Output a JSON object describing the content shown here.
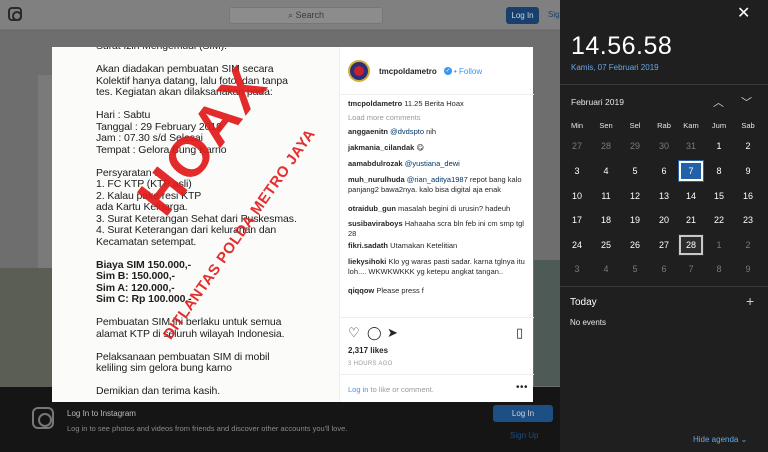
{
  "instagram": {
    "search_placeholder": "Search",
    "login_label": "Log In",
    "signup_label": "Sign Up",
    "bottom_bar": {
      "title": "Log In to Instagram",
      "subtitle": "Log in to see photos and videos from friends and discover other accounts you'll love.",
      "login_label": "Log In",
      "signup_label": "Sign Up"
    }
  },
  "post": {
    "image_text": {
      "lines": [
        "Surat Izin Mengemudi (SIM).",
        "",
        "Akan diadakan pembuatan SIM secara",
        "Kolektif hanya datang, lalu foto, dan tanpa",
        "tes. Kegiatan akan dilaksanakan pada:",
        "",
        "Hari     : Sabtu",
        "Tanggal : 29 February 2019",
        "Jam       : 07.30 s/d  Selesai",
        "Tempat : Gelora Bung Karno",
        "",
        "Persyaratan :",
        "1. FC KTP (KTP asli)",
        "2. Kalau pake resi KTP",
        "ada Kartu Keluarga.",
        "3. Surat Keterangan Sehat dari Puskesmas.",
        "4. Surat Keterangan dari kelurahan dan",
        "Kecamatan setempat.",
        "",
        "Biaya SIM 150.000,-",
        "Sim B: 150.000,-",
        "Sim A: 120.000,-",
        "Sim C: Rp 100.000,-",
        "",
        "Pembuatan SIM ini berlaku untuk semua",
        "alamat KTP di seluruh wilayah Indonesia.",
        "",
        "Pelaksanaan pembuatan SIM di mobil",
        "keliling sim gelora bung karno",
        "",
        "Demikian dan terima kasih."
      ],
      "stamp": "HOAX",
      "stamp_sub": "DITLANTAS POLDA METRO JAYA"
    },
    "header": {
      "handle": "tmcpoldametro",
      "follow_label": "Follow"
    },
    "caption": {
      "user": "tmcpoldametro",
      "text": "11.25 Berita Hoax"
    },
    "load_more": "Load more comments",
    "comments": [
      {
        "user": "anggaenitn",
        "mention": "@dvdspto",
        "text": "nih"
      },
      {
        "user": "jakmania_cilandak",
        "mention": "",
        "text": "😋"
      },
      {
        "user": "aamabdulrozak",
        "mention": "@yustiana_dewi",
        "text": ""
      },
      {
        "user": "muh_nurulhuda",
        "mention": "@rian_aditya1987",
        "text": "repot bang kalo panjang2 bawa2nya. kalo bisa digital aja enak"
      },
      {
        "user": "otraidub_gun",
        "mention": "",
        "text": "masalah begini di urusin? hadeuh"
      },
      {
        "user": "susibaviraboys",
        "mention": "",
        "text": "Hahaaha scra bln feb ini cm smp tgl 28"
      },
      {
        "user": "fikri.sadath",
        "mention": "",
        "text": "Utamakan Ketelitian"
      },
      {
        "user": "liekysihoki",
        "mention": "",
        "text": "Klo yg waras pasti sadar. karna tglnya itu loh.... WKWKWKKK yg ketepu angkat tangan.."
      },
      {
        "user": "qiqqow",
        "mention": "",
        "text": "Please press f"
      }
    ],
    "likes": "2,317 likes",
    "time_ago": "3 HOURS AGO",
    "login_prompt": {
      "link": "Log in",
      "text": " to like or comment."
    }
  },
  "calendar": {
    "time": "14.56.58",
    "date_long": "Kamis, 07 Februari 2019",
    "month_label": "Februari 2019",
    "weekdays": [
      "Min",
      "Sen",
      "Sel",
      "Rab",
      "Kam",
      "Jum",
      "Sab"
    ],
    "weeks": [
      [
        "27",
        "28",
        "29",
        "30",
        "31",
        "1",
        "2"
      ],
      [
        "3",
        "4",
        "5",
        "6",
        "7",
        "8",
        "9"
      ],
      [
        "10",
        "11",
        "12",
        "13",
        "14",
        "15",
        "16"
      ],
      [
        "17",
        "18",
        "19",
        "20",
        "21",
        "22",
        "23"
      ],
      [
        "24",
        "25",
        "26",
        "27",
        "28",
        "1",
        "2"
      ],
      [
        "3",
        "4",
        "5",
        "6",
        "7",
        "8",
        "9"
      ]
    ],
    "today_label": "Today",
    "no_events": "No events",
    "hide_agenda": "Hide agenda",
    "accent_color": "#2260a8"
  }
}
